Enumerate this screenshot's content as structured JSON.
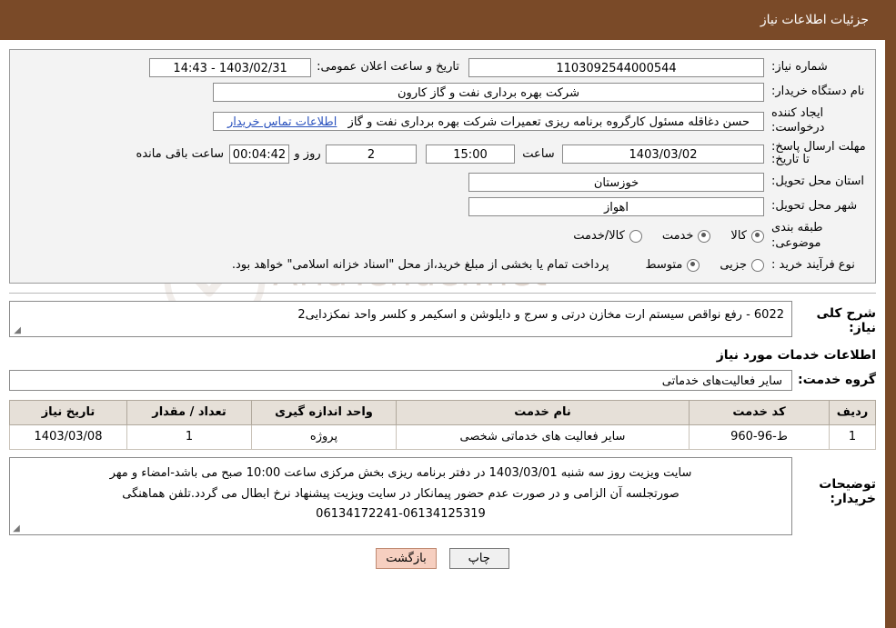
{
  "header": {
    "title": "جزئیات اطلاعات نیاز"
  },
  "watermark": {
    "text": "AriaTender",
    "suffix": ".net",
    "icon": "shield-icon"
  },
  "info": {
    "need_number_label": "شماره نیاز:",
    "need_number_value": "1103092544000544",
    "announce_date_label": "تاریخ و ساعت اعلان عمومی:",
    "announce_date_value": "1403/02/31 - 14:43",
    "buyer_org_label": "نام دستگاه خریدار:",
    "buyer_org_value": "شرکت بهره برداری نفت و گاز کارون",
    "requester_label": "ایجاد کننده درخواست:",
    "requester_value": "حسن دغاقله مسئول کارگروه برنامه ریزی تعمیرات شرکت بهره برداری نفت و گاز",
    "requester_link": "اطلاعات تماس خریدار",
    "deadline_label": "مهلت ارسال پاسخ: تا تاریخ:",
    "deadline_date": "1403/03/02",
    "deadline_time_label": "ساعت",
    "deadline_time": "15:00",
    "remaining_days": "2",
    "remaining_days_label": "روز و",
    "remaining_clock": "00:04:42",
    "remaining_suffix": "ساعت باقی مانده",
    "province_label": "استان محل تحویل:",
    "province_value": "خوزستان",
    "city_label": "شهر محل تحویل:",
    "city_value": "اهواز",
    "category_label": "طبقه بندی موضوعی:",
    "category_options": [
      {
        "label": "کالا",
        "selected": true
      },
      {
        "label": "خدمت",
        "selected": true
      },
      {
        "label": "کالا/خدمت",
        "selected": false
      }
    ],
    "purchase_type_label": "نوع فرآیند خرید :",
    "purchase_type_options": [
      {
        "label": "جزیی",
        "selected": false
      },
      {
        "label": "متوسط",
        "selected": true
      }
    ],
    "purchase_note": "پرداخت تمام یا بخشی از مبلغ خرید،از محل \"اسناد خزانه اسلامی\" خواهد بود."
  },
  "general": {
    "label": "شرح کلی نیاز:",
    "value": "6022 - رفع نواقص سیستم ارت مخازن درتی و سرج و دایلوشن و اسکیمر و کلسر واحد نمکزدایی2"
  },
  "services": {
    "heading": "اطلاعات خدمات مورد نیاز",
    "group_label": "گروه خدمت:",
    "group_value": "سایر فعالیت‌های خدماتی",
    "columns": [
      "ردیف",
      "کد خدمت",
      "نام خدمت",
      "واحد اندازه گیری",
      "تعداد / مقدار",
      "تاریخ نیاز"
    ],
    "rows": [
      {
        "index": "1",
        "code": "ط-96-960",
        "name": "سایر فعالیت های خدماتی شخصی",
        "unit": "پروژه",
        "qty": "1",
        "date": "1403/03/08"
      }
    ]
  },
  "buyer_notes": {
    "label": "توضیحات خریدار:",
    "lines": [
      "سایت ویزیت روز سه شنبه 1403/03/01 در دفتر برنامه ریزی بخش مرکزی ساعت 10:00 صبح می باشد-امضاء و مهر",
      "صورتجلسه آن الزامی و در صورت عدم حضور پیمانکار در سایت ویزیت پیشنهاد نرخ ابطال می گردد.تلفن هماهنگی",
      "06134172241-06134125319"
    ]
  },
  "buttons": {
    "print": "چاپ",
    "back": "بازگشت"
  }
}
